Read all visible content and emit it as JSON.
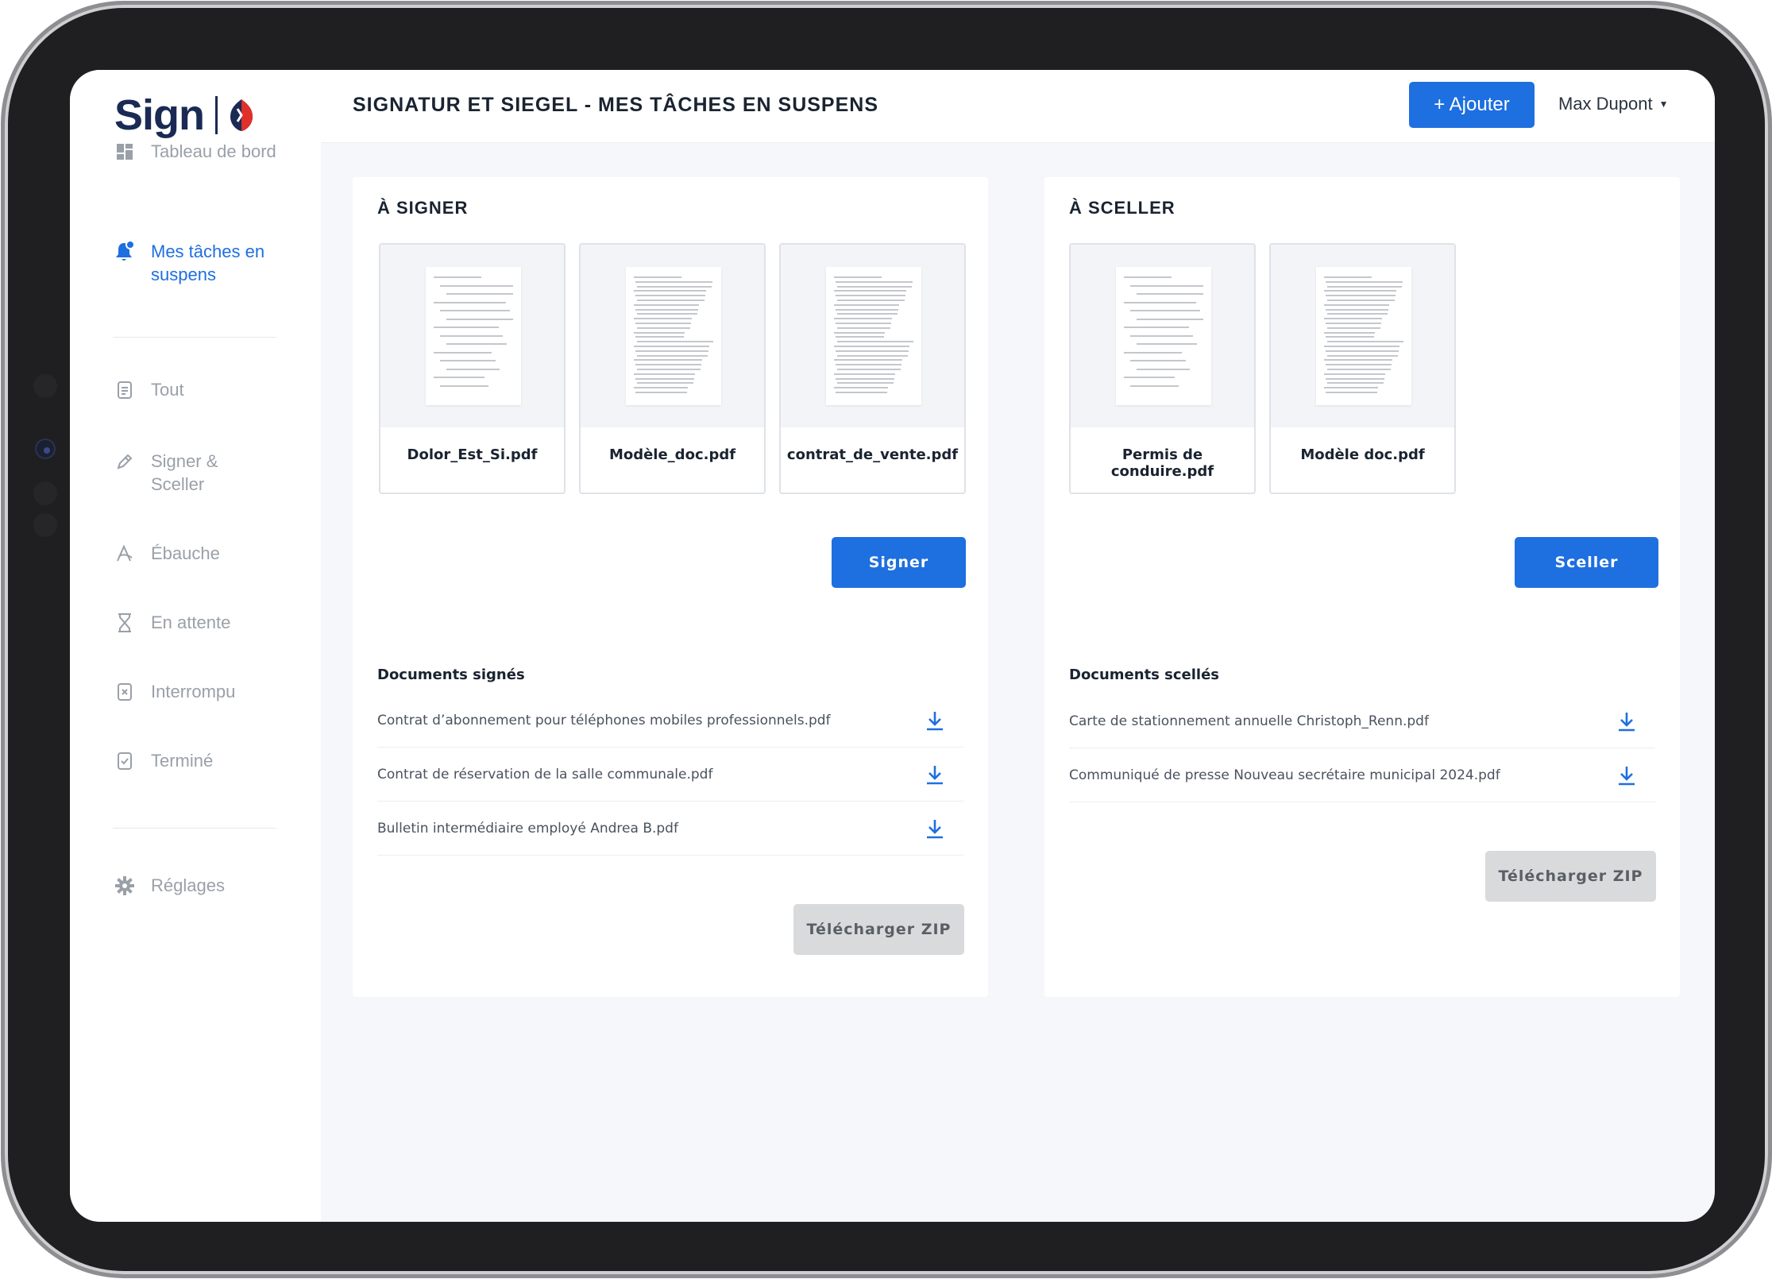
{
  "app": {
    "logo_text": "Sign",
    "title": "SIGNATUR ET SIEGEL - MES TÂCHES EN SUSPENS"
  },
  "header": {
    "add_label": "+ Ajouter",
    "user_name": "Max Dupont"
  },
  "sidebar": {
    "items": [
      {
        "label": "Tableau de bord",
        "icon": "dashboard-icon"
      },
      {
        "label": "Mes tâches en\nsuspens",
        "icon": "bell-icon",
        "active": true
      },
      {
        "label": "Tout",
        "icon": "document-icon"
      },
      {
        "label": "Signer &\nSceller",
        "icon": "pen-icon"
      },
      {
        "label": "Ébauche",
        "icon": "draft-icon"
      },
      {
        "label": "En attente",
        "icon": "hourglass-icon"
      },
      {
        "label": "Interrompu",
        "icon": "interrupted-icon"
      },
      {
        "label": "Terminé",
        "icon": "done-icon"
      },
      {
        "label": "Réglages",
        "icon": "gear-icon"
      }
    ]
  },
  "sign_panel": {
    "title": "À SIGNER",
    "documents": [
      "Dolor_Est_Si.pdf",
      "Modèle_doc.pdf",
      "contrat_de_vente.pdf"
    ],
    "action_label": "Signer",
    "section_title": "Documents signés",
    "files": [
      "Contrat d’abonnement pour téléphones mobiles professionnels.pdf",
      "Contrat de réservation de la salle communale.pdf",
      "Bulletin intermédiaire employé Andrea B.pdf"
    ],
    "zip_label": "Télécharger ZIP"
  },
  "seal_panel": {
    "title": "À SCELLER",
    "documents": [
      "Permis de conduire.pdf",
      "Modèle doc.pdf"
    ],
    "action_label": "Sceller",
    "section_title": "Documents scellés",
    "files": [
      "Carte de stationnement annuelle Christoph_Renn.pdf",
      "Communiqué de presse Nouveau secrétaire municipal 2024.pdf"
    ],
    "zip_label": "Télécharger ZIP"
  },
  "colors": {
    "accent": "#1e6fe0",
    "brand_navy": "#1a2a55",
    "brand_red": "#e0302a"
  }
}
